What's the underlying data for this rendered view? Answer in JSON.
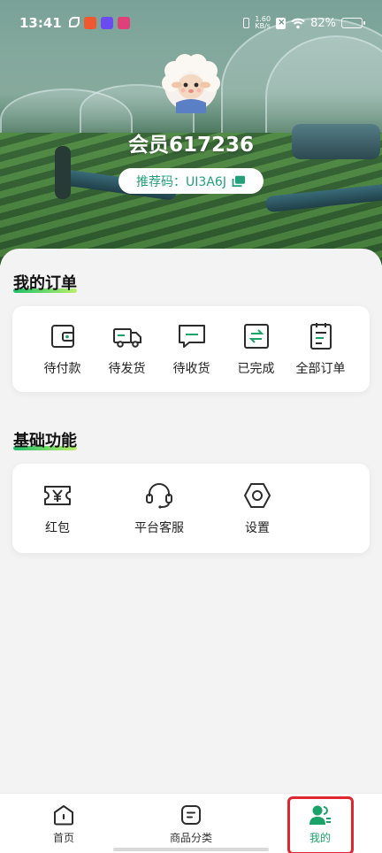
{
  "status_bar": {
    "time": "13:41",
    "speed_value": "1.60",
    "speed_unit": "KB/s",
    "battery": "82%",
    "battery_level": 0.82
  },
  "profile": {
    "member_name": "会员617236",
    "referral_label": "推荐码：UI3A6J"
  },
  "orders": {
    "title": "我的订单",
    "items": [
      {
        "label": "待付款",
        "icon": "wallet-icon"
      },
      {
        "label": "待发货",
        "icon": "truck-icon"
      },
      {
        "label": "待收货",
        "icon": "message-box-icon"
      },
      {
        "label": "已完成",
        "icon": "exchange-icon"
      },
      {
        "label": "全部订单",
        "icon": "clipboard-icon"
      }
    ]
  },
  "basic": {
    "title": "基础功能",
    "items": [
      {
        "label": "红包",
        "icon": "coupon-yen-icon"
      },
      {
        "label": "平台客服",
        "icon": "headset-icon"
      },
      {
        "label": "设置",
        "icon": "hex-settings-icon"
      }
    ]
  },
  "nav": {
    "items": [
      {
        "label": "首页",
        "icon": "home-icon"
      },
      {
        "label": "商品分类",
        "icon": "category-icon"
      },
      {
        "label": "我的",
        "icon": "user-icon",
        "active": true
      }
    ]
  },
  "colors": {
    "accent": "#1aa268",
    "highlight": "#e0262f"
  }
}
